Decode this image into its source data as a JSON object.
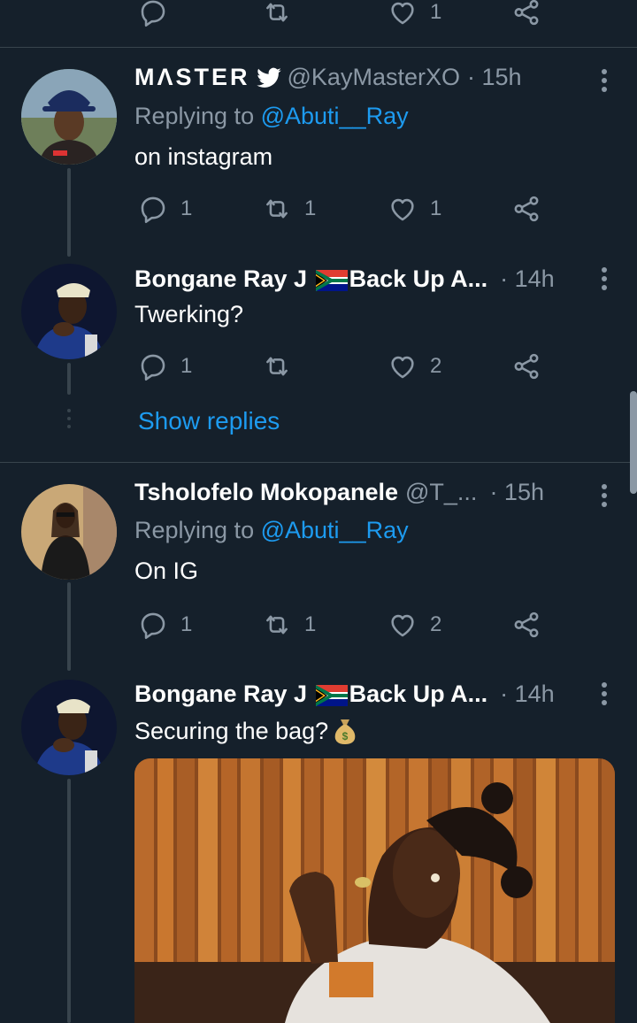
{
  "top_actions": {
    "like_count": "1"
  },
  "tweets": [
    {
      "name": "MΛSTER",
      "handle": "@KayMasterXO",
      "time": "· 15h",
      "replying_label": "Replying to",
      "replying_to": "@Abuti__Ray",
      "text": "on instagram",
      "reply_count": "1",
      "retweet_count": "1",
      "like_count": "1"
    },
    {
      "name_prefix": "Bongane Ray J",
      "name_suffix": "Back Up A...",
      "time": "· 14h",
      "text": "Twerking?",
      "reply_count": "1",
      "retweet_count": "",
      "like_count": "2",
      "show_replies": "Show replies"
    },
    {
      "name": "Tsholofelo Mokopanele",
      "handle": "@T_...",
      "time": "· 15h",
      "replying_label": "Replying to",
      "replying_to": "@Abuti__Ray",
      "text": "On IG",
      "reply_count": "1",
      "retweet_count": "1",
      "like_count": "2"
    },
    {
      "name_prefix": "Bongane Ray J",
      "name_suffix": "Back Up A...",
      "time": "· 14h",
      "text": "Securing the bag?",
      "emoji": "money-bag"
    }
  ],
  "colors": {
    "background": "#15202b",
    "divider": "#38444d",
    "secondary_text": "#8b98a5",
    "link": "#1d9bf0"
  }
}
